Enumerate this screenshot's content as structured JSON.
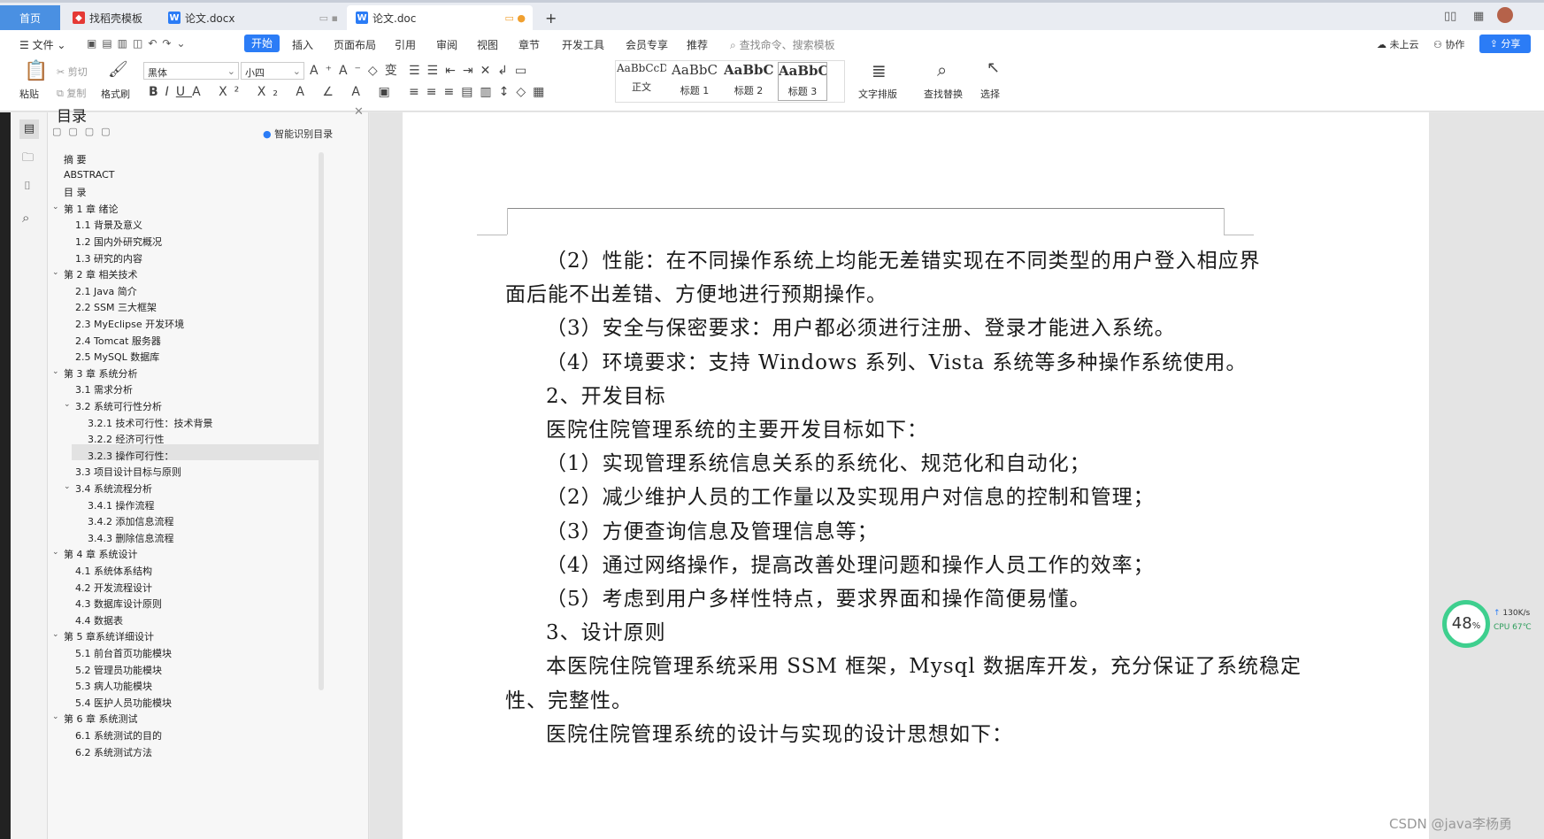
{
  "tabs": {
    "home": "首页",
    "t1": "找稻壳模板",
    "t2": "论文.docx",
    "t3": "论文.doc",
    "add": "+"
  },
  "menu": {
    "file": "文件",
    "start": "开始",
    "insert": "插入",
    "layout": "页面布局",
    "ref": "引用",
    "review": "审阅",
    "view": "视图",
    "section": "章节",
    "dev": "开发工具",
    "vip": "会员专享",
    "recommend": "推荐",
    "search": "查找命令、搜索模板",
    "cloud": "未上云",
    "collab": "协作",
    "share": "分享"
  },
  "ribbon": {
    "paste": "粘贴",
    "cut": "剪切",
    "copy": "复制",
    "format_painter": "格式刷",
    "font": "黑体",
    "size": "小四",
    "styles": [
      {
        "preview": "AaBbCcDd",
        "label": "正文"
      },
      {
        "preview": "AaBbC",
        "label": "标题 1"
      },
      {
        "preview": "AaBbC",
        "label": "标题 2"
      },
      {
        "preview": "AaBbC",
        "label": "标题 3"
      }
    ],
    "text_layout": "文字排版",
    "find_replace": "查找替换",
    "select": "选择"
  },
  "toc": {
    "title": "目录",
    "smart": "智能识别目录",
    "items": [
      "摘  要",
      "ABSTRACT",
      "目  录",
      "第 1 章  绪论",
      "1.1 背景及意义",
      "1.2  国内外研究概况",
      "1.3  研究的内容",
      "第 2 章  相关技术",
      "2.1 Java 简介",
      "2.2 SSM 三大框架",
      "2.3 MyEclipse 开发环境",
      "2.4 Tomcat 服务器",
      "2.5 MySQL 数据库",
      "第 3 章  系统分析",
      "3.1  需求分析",
      "3.2  系统可行性分析",
      "3.2.1 技术可行性：技术背景",
      "3.2.2 经济可行性",
      "3.2.3 操作可行性：",
      "3.3  项目设计目标与原则",
      "3.4 系统流程分析",
      "3.4.1 操作流程",
      "3.4.2 添加信息流程",
      "3.4.3 删除信息流程",
      "第 4 章  系统设计",
      "4.1  系统体系结构",
      "4.2 开发流程设计",
      "4.3  数据库设计原则",
      "4.4  数据表",
      "第 5 章系统详细设计",
      "5.1 前台首页功能模块",
      "5.2 管理员功能模块",
      "5.3 病人功能模块",
      "5.4 医护人员功能模块",
      "第 6 章    系统测试",
      "6.1 系统测试的目的",
      "6.2 系统测试方法"
    ]
  },
  "doc": {
    "lines": [
      "（2）性能：在不同操作系统上均能无差错实现在不同类型的用户登入相应界",
      "面后能不出差错、方便地进行预期操作。",
      "（3）安全与保密要求：用户都必须进行注册、登录才能进入系统。",
      "（4）环境要求：支持 Windows 系列、Vista 系统等多种操作系统使用。",
      "2、开发目标",
      "医院住院管理系统的主要开发目标如下：",
      "（1）实现管理系统信息关系的系统化、规范化和自动化；",
      "（2）减少维护人员的工作量以及实现用户对信息的控制和管理；",
      "（3）方便查询信息及管理信息等；",
      "（4）通过网络操作，提高改善处理问题和操作人员工作的效率；",
      "（5）考虑到用户多样性特点，要求界面和操作简便易懂。",
      "3、设计原则",
      "本医院住院管理系统采用 SSM 框架，Mysql 数据库开发，充分保证了系统稳定",
      "性、完整性。",
      "医院住院管理系统的设计与实现的设计思想如下："
    ]
  },
  "widget": {
    "percent": "48",
    "percent_sign": "%",
    "speed": "130K/s",
    "cpu": "CPU 67℃"
  },
  "watermark": "CSDN @java李杨勇",
  "colors": {
    "accent": "#2b7cf6",
    "home_tab": "#4a90e2"
  }
}
